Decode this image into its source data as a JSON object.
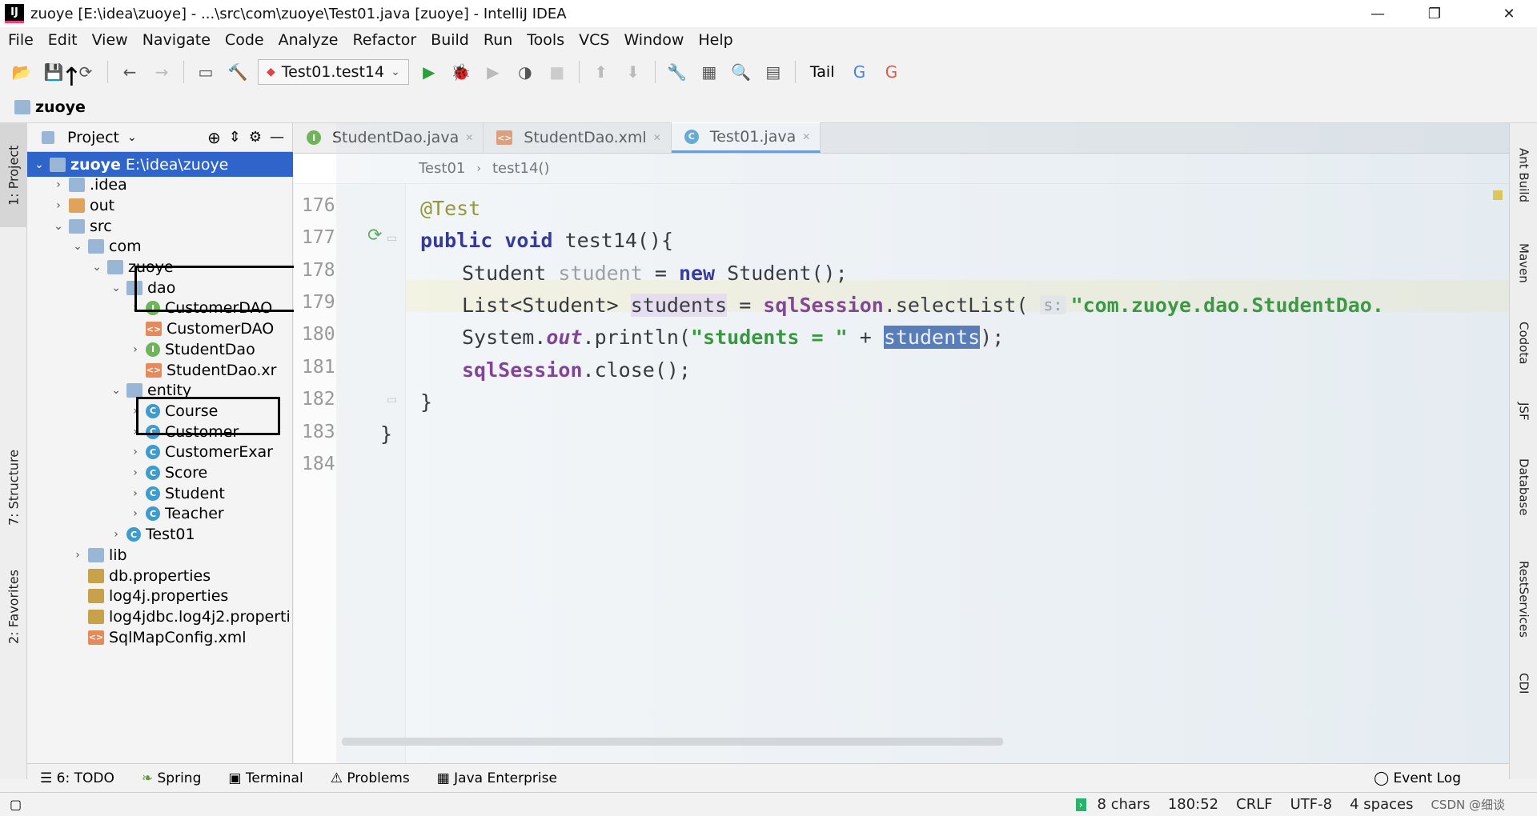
{
  "window": {
    "app_icon": "IJ",
    "title": "zuoye [E:\\idea\\zuoye] - ...\\src\\com\\zuoye\\Test01.java [zuoye] - IntelliJ IDEA",
    "minimize": "—",
    "maximize": "❐",
    "close": "✕"
  },
  "menu": [
    "File",
    "Edit",
    "View",
    "Navigate",
    "Code",
    "Analyze",
    "Refactor",
    "Build",
    "Run",
    "Tools",
    "VCS",
    "Window",
    "Help"
  ],
  "toolbar": {
    "run_config": "Test01.test14",
    "tail_label": "Tail"
  },
  "navbar": {
    "project": "zuoye"
  },
  "left_tabs": {
    "project": "1: Project",
    "structure": "7: Structure",
    "favorites": "2: Favorites"
  },
  "project_panel": {
    "title": "Project",
    "tree": [
      {
        "label": "zuoye",
        "extra": "E:\\idea\\zuoye",
        "indent": 0,
        "arrow": "⌄",
        "icon": "folder",
        "selected": true
      },
      {
        "label": ".idea",
        "indent": 1,
        "arrow": "›",
        "icon": "folder"
      },
      {
        "label": "out",
        "indent": 1,
        "arrow": "›",
        "icon": "folder-orange"
      },
      {
        "label": "src",
        "indent": 1,
        "arrow": "⌄",
        "icon": "folder"
      },
      {
        "label": "com",
        "indent": 2,
        "arrow": "⌄",
        "icon": "folder"
      },
      {
        "label": "zuoye",
        "indent": 3,
        "arrow": "⌄",
        "icon": "folder"
      },
      {
        "label": "dao",
        "indent": 4,
        "arrow": "⌄",
        "icon": "folder"
      },
      {
        "label": "CustomerDAO",
        "indent": 5,
        "arrow": "›",
        "icon": "interface"
      },
      {
        "label": "CustomerDAO",
        "indent": 5,
        "arrow": "",
        "icon": "xml"
      },
      {
        "label": "StudentDao",
        "indent": 5,
        "arrow": "›",
        "icon": "interface"
      },
      {
        "label": "StudentDao.xr",
        "indent": 5,
        "arrow": "",
        "icon": "xml"
      },
      {
        "label": "entity",
        "indent": 4,
        "arrow": "⌄",
        "icon": "folder"
      },
      {
        "label": "Course",
        "indent": 5,
        "arrow": "›",
        "icon": "class"
      },
      {
        "label": "Customer",
        "indent": 5,
        "arrow": "›",
        "icon": "class"
      },
      {
        "label": "CustomerExar",
        "indent": 5,
        "arrow": "›",
        "icon": "class"
      },
      {
        "label": "Score",
        "indent": 5,
        "arrow": "›",
        "icon": "class"
      },
      {
        "label": "Student",
        "indent": 5,
        "arrow": "›",
        "icon": "class"
      },
      {
        "label": "Teacher",
        "indent": 5,
        "arrow": "›",
        "icon": "class"
      },
      {
        "label": "Test01",
        "indent": 4,
        "arrow": "›",
        "icon": "class"
      },
      {
        "label": "lib",
        "indent": 2,
        "arrow": "›",
        "icon": "folder"
      },
      {
        "label": "db.properties",
        "indent": 2,
        "arrow": "",
        "icon": "properties"
      },
      {
        "label": "log4j.properties",
        "indent": 2,
        "arrow": "",
        "icon": "properties"
      },
      {
        "label": "log4jdbc.log4j2.properti",
        "indent": 2,
        "arrow": "",
        "icon": "properties"
      },
      {
        "label": "SqlMapConfig.xml",
        "indent": 2,
        "arrow": "",
        "icon": "xml"
      }
    ]
  },
  "editor": {
    "tabs": [
      {
        "label": "StudentDao.java",
        "icon": "I",
        "active": false
      },
      {
        "label": "StudentDao.xml",
        "icon": "xml",
        "active": false
      },
      {
        "label": "Test01.java",
        "icon": "C",
        "active": true
      }
    ],
    "breadcrumbs": [
      "Test01",
      "test14()"
    ],
    "line_numbers": [
      "176",
      "177",
      "178",
      "179",
      "180",
      "181",
      "182",
      "183",
      "184"
    ],
    "hint_label": "s:"
  },
  "right_tabs": [
    "Ant Build",
    "Maven",
    "Codota",
    "JSF",
    "Database",
    "RestServices",
    "CDI"
  ],
  "bottom_tools": [
    "6: TODO",
    "Spring",
    "Terminal",
    "Problems",
    "Java Enterprise",
    "Event Log"
  ],
  "status": {
    "chars": "8 chars",
    "position": "180:52",
    "line_sep": "CRLF",
    "encoding": "UTF-8",
    "indent": "4 spaces",
    "watermark": "CSDN @细谈"
  },
  "colors": {
    "selection": "#2f65ca",
    "keyword": "#000080",
    "string": "#008000",
    "field": "#660e7a"
  }
}
